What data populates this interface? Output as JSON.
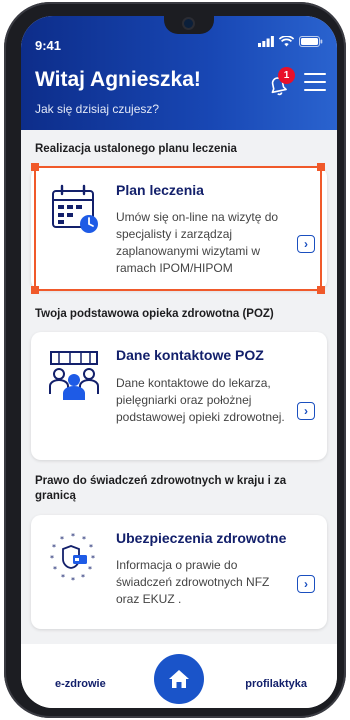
{
  "status_bar": {
    "time": "9:41"
  },
  "header": {
    "greeting": "Witaj Agnieszka!",
    "subtitle": "Jak się dzisiaj czujesz?",
    "notification_count": "1"
  },
  "sections": [
    {
      "title": "Realizacja ustalonego planu leczenia",
      "card": {
        "title": "Plan leczenia",
        "description": "Umów się on-line na wizytę do specjalisty i zarządzaj zaplanowanymi wizytami w ramach IPOM/HIPOM",
        "icon": "calendar-icon"
      }
    },
    {
      "title": "Twoja podstawowa opieka zdrowotna (POZ)",
      "card": {
        "title": "Dane kontaktowe POZ",
        "description": "Dane kontaktowe do lekarza, pielęgniarki oraz położnej podstawowej opieki zdrowotnej.",
        "icon": "medical-staff-icon"
      }
    },
    {
      "title": "Prawo do świadczeń zdrowotnych w kraju i za granicą",
      "card": {
        "title": "Ubezpieczenia zdrowotne",
        "description": "Informacja o prawie do świadczeń zdrowotnych NFZ oraz EKUZ .",
        "icon": "eu-insurance-icon"
      }
    }
  ],
  "bottom_nav": {
    "left": "e-zdrowie",
    "right": "profilaktyka"
  },
  "colors": {
    "header": "#1847b4",
    "accent": "#1a4fbf",
    "highlight": "#f0592a",
    "badge": "#e8102a"
  }
}
